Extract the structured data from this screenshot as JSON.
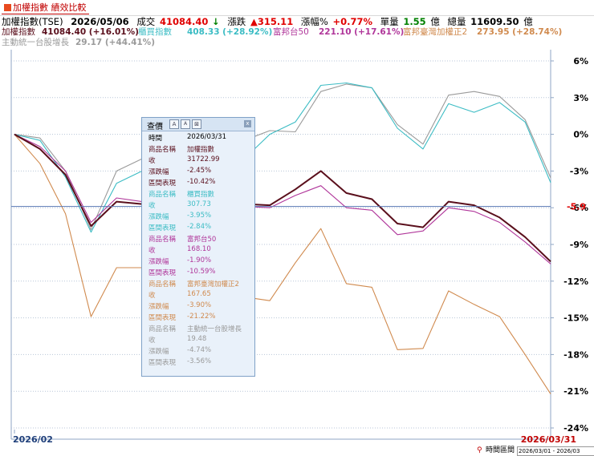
{
  "app": {
    "tab_label": "加權指數 績效比較"
  },
  "summary": {
    "name": "加權指數(TSE)",
    "date": "2026/05/06",
    "price_label": "成交",
    "price": "41084.40",
    "price_arrow": "↓",
    "change_label": "漲跌",
    "change": "▲315.11",
    "pct_label": "漲幅%",
    "pct": "+0.77%",
    "volume_label": "單量",
    "volume": "1.55",
    "volume_unit": "億",
    "total_label": "總量",
    "total": "11609.50",
    "total_unit": "億"
  },
  "colors": {
    "index": "#5a0f1c",
    "etf_cyan": "#3bbcc4",
    "etf_magenta": "#b0369a",
    "etf_orange": "#d08a4e",
    "etf_gray": "#9a9a9a",
    "red": "#e00000",
    "green": "#008000"
  },
  "legend": [
    {
      "name": "加權指數",
      "value": "41084.40 (+16.01%)"
    },
    {
      "name": "櫃買指數",
      "value": "408.33 (+28.92%)"
    },
    {
      "name": "富邦台50",
      "value": "221.10 (+17.61%)"
    },
    {
      "name": "富邦臺灣加權正2",
      "value": "273.95 (+28.74%)"
    },
    {
      "name": "主動統一台股增長",
      "value": "29.17 (+44.41%)"
    }
  ],
  "chart_data": {
    "type": "line",
    "x_range": [
      "2026/02",
      "2026/03/31"
    ],
    "y_unit": "%",
    "ylim": [
      -24,
      6
    ],
    "yticks": [
      6,
      3,
      0,
      -3,
      -6,
      -9,
      -12,
      -15,
      -18,
      -21,
      -24
    ],
    "ytick_labels": [
      "6%",
      "3%",
      "0%",
      "-3%",
      "-6%",
      "-9%",
      "-12%",
      "-15%",
      "-18%",
      "-21%",
      "-24%"
    ],
    "crosshair_label": "-5.9",
    "crosshair_y": -5.9,
    "x_start_label": "2026/02",
    "x_end_label": "2026/03/31",
    "series": [
      {
        "name": "加權指數",
        "values": [
          0,
          -1.2,
          -3.3,
          -7.5,
          -5.5,
          -5.7,
          -5.8,
          -6.2,
          -5.5,
          -5.7,
          -5.8,
          -4.5,
          -3.0,
          -4.8,
          -5.3,
          -7.3,
          -7.6,
          -5.5,
          -5.8,
          -6.8,
          -8.4,
          -10.4
        ]
      },
      {
        "name": "櫃買指數",
        "values": [
          0,
          -0.5,
          -3.5,
          -8.0,
          -4.0,
          -3.0,
          -1.2,
          -2.0,
          -2.5,
          -2.0,
          0.0,
          1.0,
          4.0,
          4.2,
          3.8,
          0.5,
          -1.2,
          2.5,
          1.8,
          2.6,
          1.0,
          -3.95
        ]
      },
      {
        "name": "富邦台50",
        "values": [
          0,
          -1.0,
          -3.0,
          -7.2,
          -5.2,
          -5.5,
          -5.6,
          -6.0,
          -5.7,
          -5.9,
          -6.0,
          -5.0,
          -4.2,
          -6.0,
          -6.2,
          -8.2,
          -7.9,
          -6.0,
          -6.3,
          -7.2,
          -8.8,
          -10.59
        ]
      },
      {
        "name": "富邦臺灣加權正2",
        "values": [
          0,
          -2.4,
          -6.5,
          -14.9,
          -10.9,
          -10.9,
          -12.0,
          -13.0,
          -13.2,
          -13.3,
          -13.6,
          -10.5,
          -7.7,
          -12.2,
          -12.5,
          -17.6,
          -17.5,
          -12.8,
          -13.9,
          -14.9,
          -18.0,
          -21.22
        ]
      },
      {
        "name": "主動統一台股增長",
        "values": [
          0,
          -0.3,
          -3.0,
          -7.8,
          -3.0,
          -2.0,
          -1.5,
          -1.4,
          -1.2,
          -0.5,
          0.3,
          0.2,
          3.5,
          4.1,
          3.8,
          0.8,
          -0.8,
          3.2,
          3.5,
          3.1,
          1.2,
          -3.56
        ]
      }
    ]
  },
  "tooltip": {
    "title": "查價",
    "btn1": "A",
    "btn2": "A",
    "btn3": "⊠",
    "close": "x",
    "rows": [
      {
        "k": "時間",
        "v": "2026/03/31",
        "c": "#000000"
      },
      {
        "k": "商品名稱",
        "v": "加權指數",
        "c": "#5a0f1c"
      },
      {
        "k": "收",
        "v": "31722.99",
        "c": "#5a0f1c"
      },
      {
        "k": "漲跌幅",
        "v": "-2.45%",
        "c": "#5a0f1c"
      },
      {
        "k": "區間表現",
        "v": "-10.42%",
        "c": "#5a0f1c"
      },
      {
        "k": "商品名稱",
        "v": "櫃買指數",
        "c": "#3bbcc4"
      },
      {
        "k": "收",
        "v": "307.73",
        "c": "#3bbcc4"
      },
      {
        "k": "漲跌幅",
        "v": "-3.95%",
        "c": "#3bbcc4"
      },
      {
        "k": "區間表現",
        "v": "-2.84%",
        "c": "#3bbcc4"
      },
      {
        "k": "商品名稱",
        "v": "富邦台50",
        "c": "#b0369a"
      },
      {
        "k": "收",
        "v": "168.10",
        "c": "#b0369a"
      },
      {
        "k": "漲跌幅",
        "v": "-1.90%",
        "c": "#b0369a"
      },
      {
        "k": "區間表現",
        "v": "-10.59%",
        "c": "#b0369a"
      },
      {
        "k": "商品名稱",
        "v": "富邦臺灣加權正2",
        "c": "#d08a4e"
      },
      {
        "k": "收",
        "v": "167.65",
        "c": "#d08a4e"
      },
      {
        "k": "漲跌幅",
        "v": "-3.90%",
        "c": "#d08a4e"
      },
      {
        "k": "區間表現",
        "v": "-21.22%",
        "c": "#d08a4e"
      },
      {
        "k": "商品名稱",
        "v": "主動統一台股增長",
        "c": "#9a9a9a"
      },
      {
        "k": "收",
        "v": "19.48",
        "c": "#9a9a9a"
      },
      {
        "k": "漲跌幅",
        "v": "-4.74%",
        "c": "#9a9a9a"
      },
      {
        "k": "區間表現",
        "v": "-3.56%",
        "c": "#9a9a9a"
      }
    ]
  },
  "bottom": {
    "label": "時間區間",
    "range": "2026/03/01 - 2026/03"
  }
}
